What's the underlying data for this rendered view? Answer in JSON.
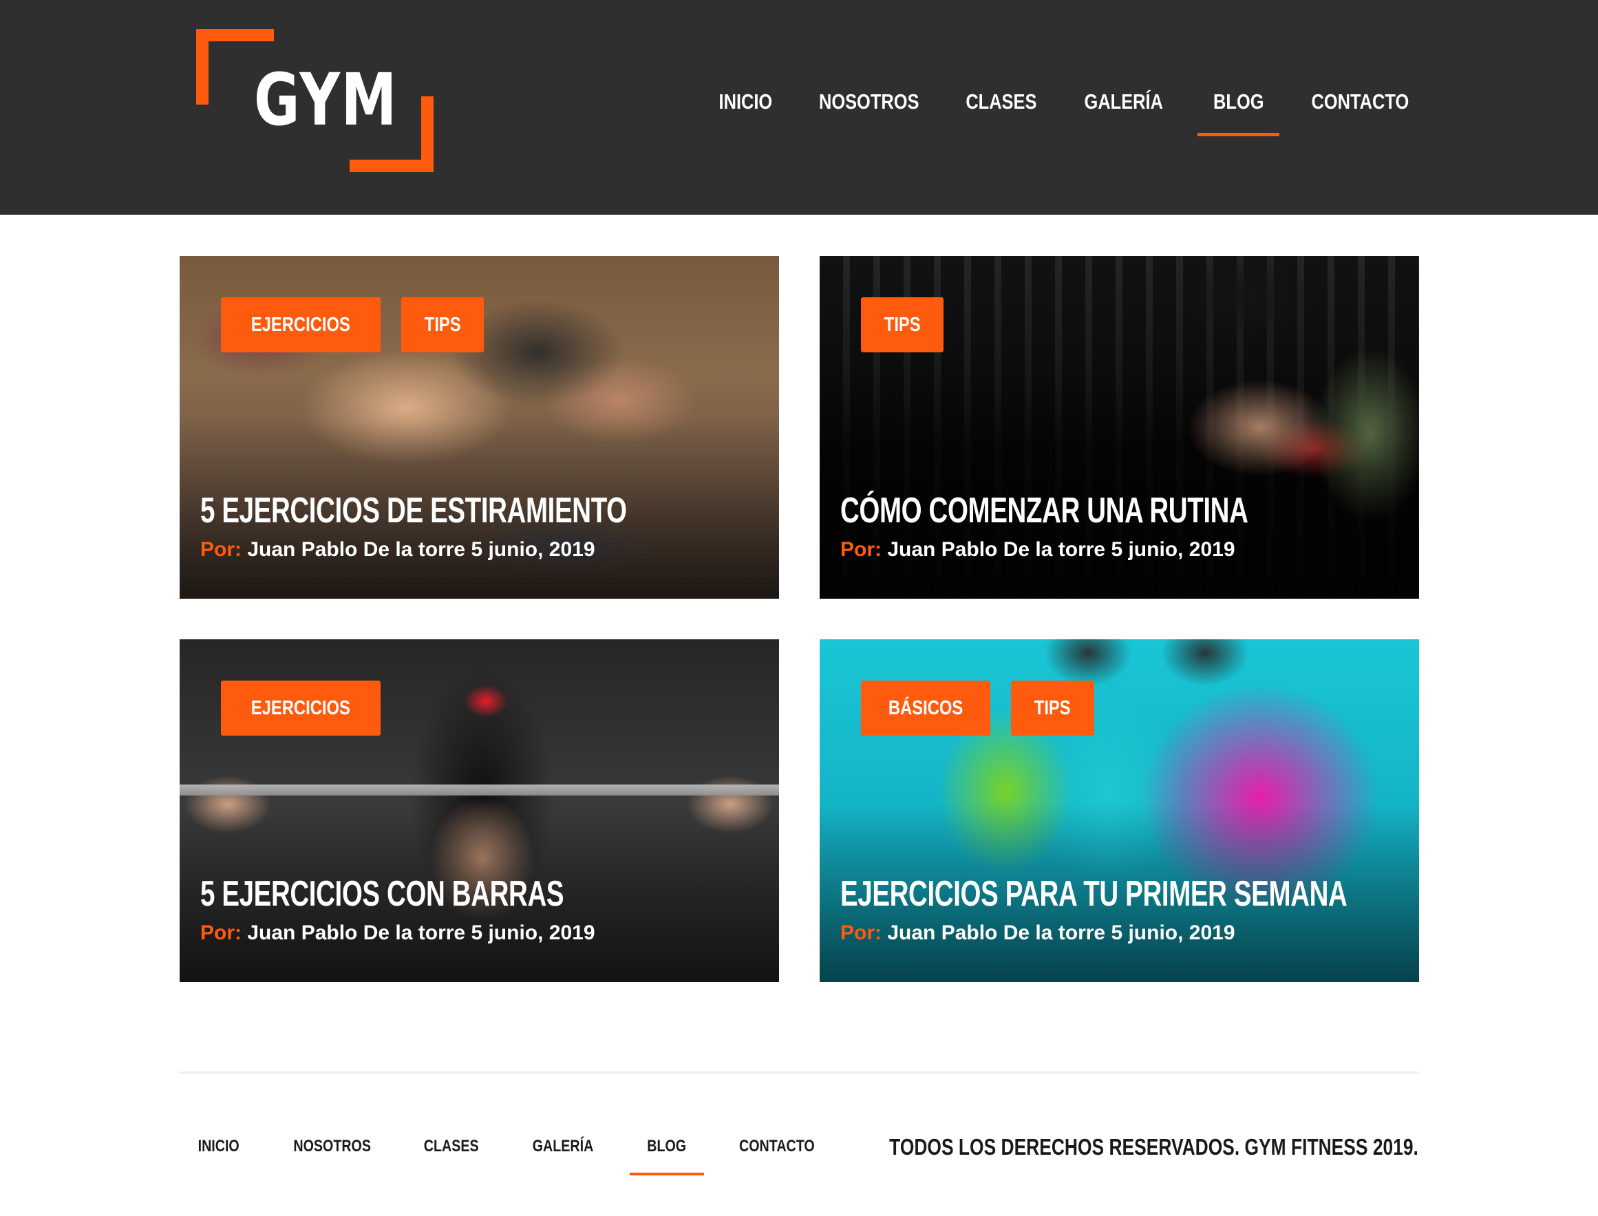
{
  "brand": {
    "logo_text": "GYM",
    "accent": "#ff5b0e",
    "header_bg": "#2f2f2f"
  },
  "header": {
    "nav": [
      {
        "label": "INICIO"
      },
      {
        "label": "NOSOTROS"
      },
      {
        "label": "CLASES"
      },
      {
        "label": "GALERÍA"
      },
      {
        "label": "BLOG",
        "active": true
      },
      {
        "label": "CONTACTO"
      }
    ]
  },
  "posts": [
    {
      "tags": [
        "EJERCICIOS",
        "TIPS"
      ],
      "title": "5 EJERCICIOS DE ESTIRAMIENTO",
      "by_label": "Por:",
      "author": "Juan Pablo De la torre",
      "date": "5 junio, 2019",
      "image": "stretching-class-photo"
    },
    {
      "tags": [
        "TIPS"
      ],
      "title": "CÓMO COMENZAR UNA RUTINA",
      "by_label": "Por:",
      "author": "Juan Pablo De la torre",
      "date": "5 junio, 2019",
      "image": "dumbbell-press-photo"
    },
    {
      "tags": [
        "EJERCICIOS"
      ],
      "title": "5 EJERCICIOS CON BARRAS",
      "by_label": "Por:",
      "author": "Juan Pablo De la torre",
      "date": "5 junio, 2019",
      "image": "barbell-bench-photo"
    },
    {
      "tags": [
        "BÁSICOS",
        "TIPS"
      ],
      "title": "EJERCICIOS PARA TU PRIMER SEMANA",
      "by_label": "Por:",
      "author": "Juan Pablo De la torre",
      "date": "5 junio, 2019",
      "image": "kettlebells-photo"
    }
  ],
  "footer": {
    "nav": [
      {
        "label": "INICIO"
      },
      {
        "label": "NOSOTROS"
      },
      {
        "label": "CLASES"
      },
      {
        "label": "GALERÍA"
      },
      {
        "label": "BLOG",
        "active": true
      },
      {
        "label": "CONTACTO"
      }
    ],
    "copyright": "TODOS LOS DERECHOS RESERVADOS. GYM FITNESS 2019."
  }
}
